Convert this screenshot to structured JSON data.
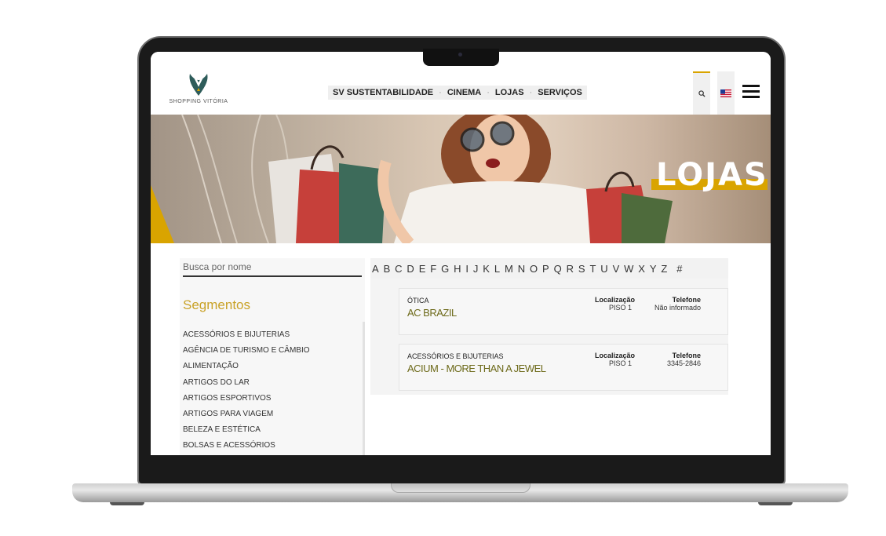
{
  "colors": {
    "accent": "#d9a400",
    "store_name": "#6d6a1a",
    "segments_title": "#c9a227"
  },
  "header": {
    "logo_text": "SHOPPING VITÓRIA",
    "nav": [
      "SV SUSTENTABILIDADE",
      "CINEMA",
      "LOJAS",
      "SERVIÇOS"
    ],
    "search_icon": "search-icon",
    "flag_icon": "us-flag-icon",
    "menu_icon": "hamburger-icon"
  },
  "hero": {
    "title": "LOJAS"
  },
  "sidebar": {
    "search_placeholder": "Busca por nome",
    "segments_title": "Segmentos",
    "segments": [
      "ACESSÓRIOS E BIJUTERIAS",
      "AGÊNCIA DE TURISMO E CÂMBIO",
      "ALIMENTAÇÃO",
      "ARTIGOS DO LAR",
      "ARTIGOS ESPORTIVOS",
      "ARTIGOS PARA VIAGEM",
      "BELEZA E ESTÉTICA",
      "BOLSAS E ACESSÓRIOS"
    ]
  },
  "alphabet": [
    "A",
    "B",
    "C",
    "D",
    "E",
    "F",
    "G",
    "H",
    "I",
    "J",
    "K",
    "L",
    "M",
    "N",
    "O",
    "P",
    "Q",
    "R",
    "S",
    "T",
    "U",
    "V",
    "W",
    "X",
    "Y",
    "Z",
    "#"
  ],
  "stores": [
    {
      "segment": "ÓTICA",
      "name": "AC BRAZIL",
      "location_label": "Localização",
      "location": "PISO 1",
      "phone_label": "Telefone",
      "phone": "Não informado"
    },
    {
      "segment": "ACESSÓRIOS E BIJUTERIAS",
      "name": "ACIUM - MORE THAN A JEWEL",
      "location_label": "Localização",
      "location": "PISO 1",
      "phone_label": "Telefone",
      "phone": "3345-2846"
    }
  ]
}
